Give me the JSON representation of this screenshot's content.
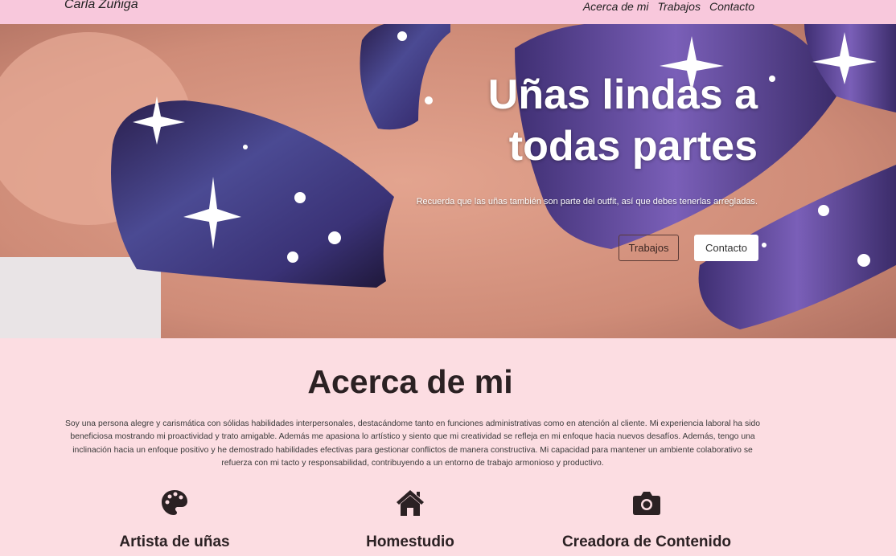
{
  "nav": {
    "brand": "Carla Zuñiga",
    "links": [
      "Acerca de mi",
      "Trabajos",
      "Contacto"
    ]
  },
  "hero": {
    "title_line1": "Uñas lindas a",
    "title_line2": "todas partes",
    "subtitle": "Recuerda que las uñas también son parte del outfit, así que debes tenerlas arregladas.",
    "buttons": [
      "Trabajos",
      "Contacto"
    ]
  },
  "about": {
    "title": "Acerca de mi",
    "text": "Soy una persona alegre y carismática con sólidas habilidades interpersonales, destacándome tanto en funciones administrativas como en atención al cliente. Mi experiencia laboral ha sido beneficiosa mostrando mi proactividad y trato amigable. Además me apasiona lo artístico y siento que mi creatividad se refleja en mi enfoque hacia nuevos desafíos. Además, tengo una inclinación hacia un enfoque positivo y he demostrado habilidades efectivas para gestionar conflictos de manera constructiva. Mi capacidad para mantener un ambiente colaborativo se refuerza con mi tacto y responsabilidad, contribuyendo a un entorno de trabajo armonioso y productivo."
  },
  "services": [
    {
      "icon": "palette-icon",
      "title": "Artista de uñas"
    },
    {
      "icon": "home-icon",
      "title": "Homestudio"
    },
    {
      "icon": "camera-icon",
      "title": "Creadora de Contenido"
    }
  ],
  "colors": {
    "navbar": "#f8c8dc",
    "page_bg": "#fcdde2",
    "heading": "#2b2123"
  }
}
